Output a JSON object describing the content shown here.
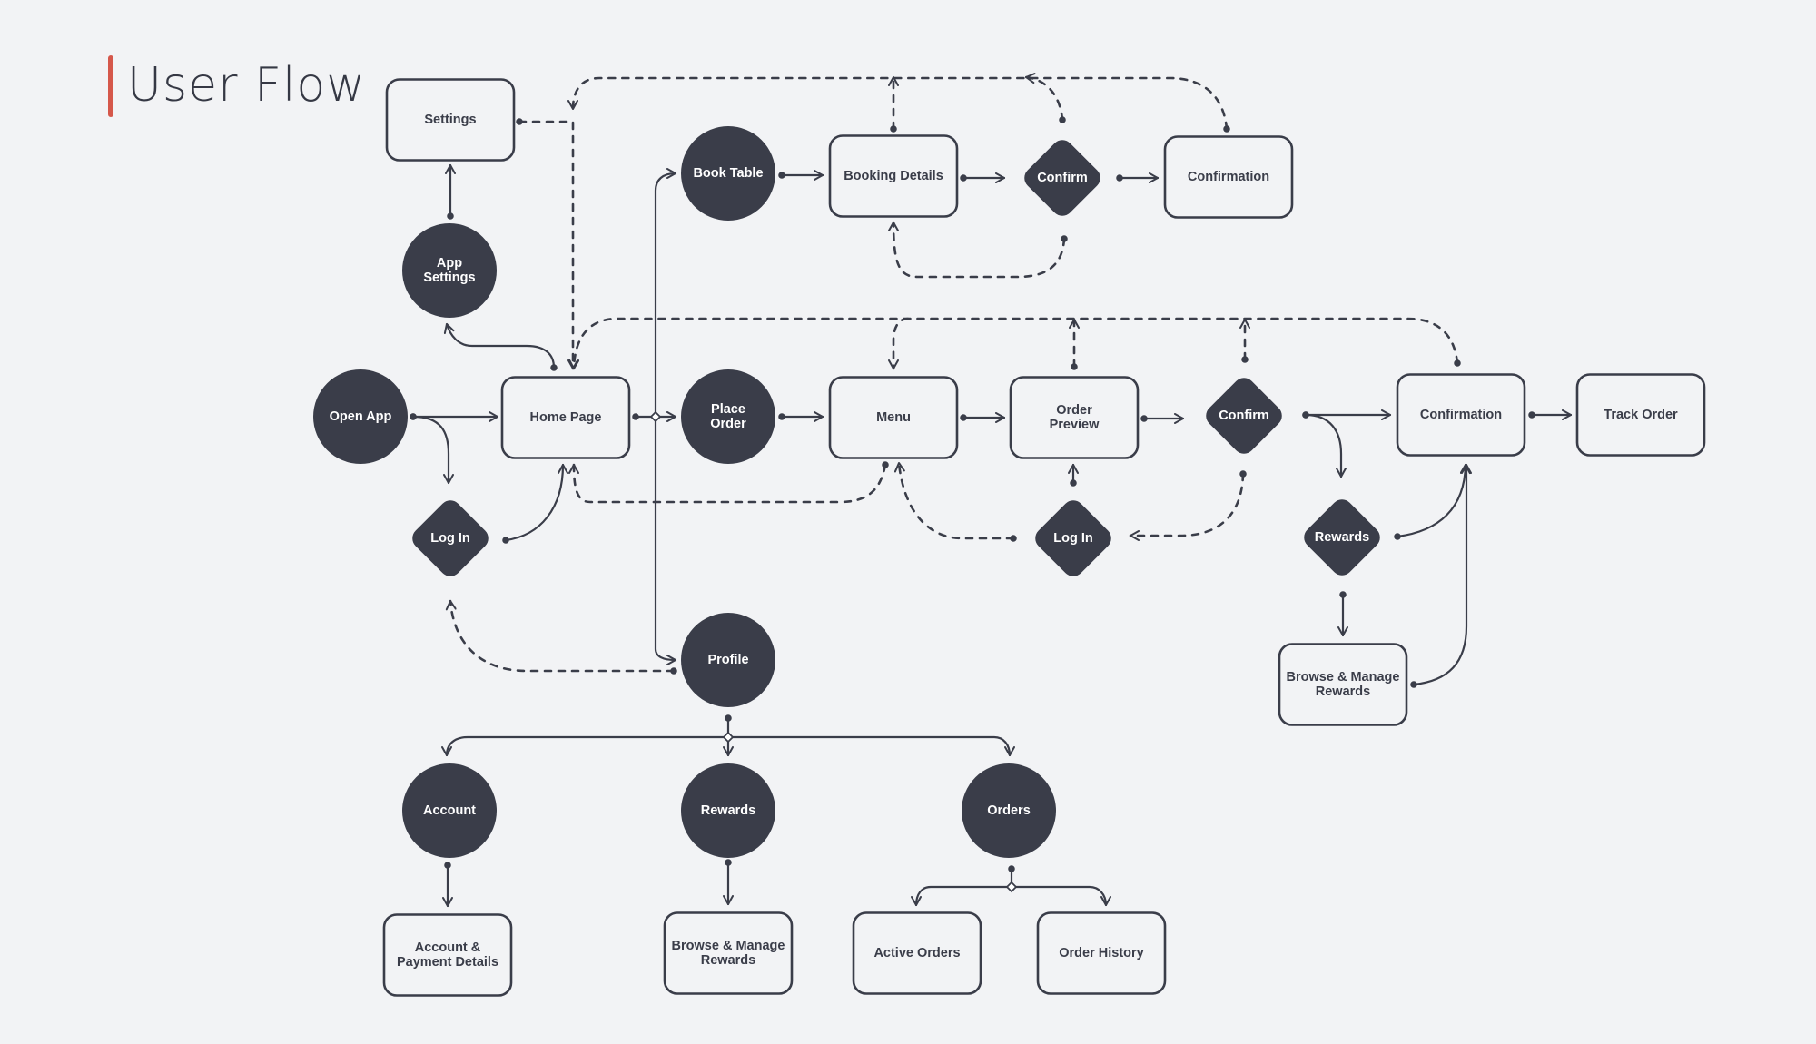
{
  "title": "User Flow",
  "colors": {
    "background": "#f2f3f5",
    "node_dark": "#3a3d49",
    "stroke": "#3a3d49",
    "accent": "#d5574a",
    "box_fill": "#f2f3f5"
  },
  "nodes": [
    {
      "id": "settings",
      "kind": "box",
      "lines": [
        "Settings"
      ]
    },
    {
      "id": "app-settings",
      "kind": "circle",
      "lines": [
        "App",
        "Settings"
      ]
    },
    {
      "id": "open-app",
      "kind": "circle",
      "lines": [
        "Open App"
      ]
    },
    {
      "id": "home-page",
      "kind": "box",
      "lines": [
        "Home Page"
      ]
    },
    {
      "id": "log-in-left",
      "kind": "diamond",
      "lines": [
        "Log In"
      ]
    },
    {
      "id": "book-table",
      "kind": "circle",
      "lines": [
        "Book Table"
      ]
    },
    {
      "id": "booking-details",
      "kind": "box",
      "lines": [
        "Booking Details"
      ]
    },
    {
      "id": "confirm-booking",
      "kind": "diamond",
      "lines": [
        "Confirm"
      ]
    },
    {
      "id": "confirmation-booking",
      "kind": "box",
      "lines": [
        "Confirmation"
      ]
    },
    {
      "id": "place-order",
      "kind": "circle",
      "lines": [
        "Place",
        "Order"
      ]
    },
    {
      "id": "menu",
      "kind": "box",
      "lines": [
        "Menu"
      ]
    },
    {
      "id": "order-preview",
      "kind": "box",
      "lines": [
        "Order",
        "Preview"
      ]
    },
    {
      "id": "confirm-order",
      "kind": "diamond",
      "lines": [
        "Confirm"
      ]
    },
    {
      "id": "confirmation-order",
      "kind": "box",
      "lines": [
        "Confirmation"
      ]
    },
    {
      "id": "track-order",
      "kind": "box",
      "lines": [
        "Track Order"
      ]
    },
    {
      "id": "log-in-order",
      "kind": "diamond",
      "lines": [
        "Log In"
      ]
    },
    {
      "id": "rewards-decision",
      "kind": "diamond",
      "lines": [
        "Rewards"
      ]
    },
    {
      "id": "browse-rewards-order",
      "kind": "box",
      "lines": [
        "Browse & Manage",
        "Rewards"
      ]
    },
    {
      "id": "profile",
      "kind": "circle",
      "lines": [
        "Profile"
      ]
    },
    {
      "id": "account",
      "kind": "circle",
      "lines": [
        "Account"
      ]
    },
    {
      "id": "rewards-profile",
      "kind": "circle",
      "lines": [
        "Rewards"
      ]
    },
    {
      "id": "orders",
      "kind": "circle",
      "lines": [
        "Orders"
      ]
    },
    {
      "id": "account-payment",
      "kind": "box",
      "lines": [
        "Account &",
        "Payment Details"
      ]
    },
    {
      "id": "browse-rewards-profile",
      "kind": "box",
      "lines": [
        "Browse & Manage",
        "Rewards"
      ]
    },
    {
      "id": "active-orders",
      "kind": "box",
      "lines": [
        "Active Orders"
      ]
    },
    {
      "id": "order-history",
      "kind": "box",
      "lines": [
        "Order History"
      ]
    }
  ],
  "edges": [
    {
      "from": "open-app",
      "to": "home-page",
      "style": "solid"
    },
    {
      "from": "open-app",
      "to": "log-in-left",
      "style": "solid"
    },
    {
      "from": "log-in-left",
      "to": "home-page",
      "style": "solid"
    },
    {
      "from": "home-page",
      "to": "app-settings",
      "style": "solid"
    },
    {
      "from": "app-settings",
      "to": "settings",
      "style": "solid"
    },
    {
      "from": "settings",
      "to": "home-page",
      "style": "dashed"
    },
    {
      "from": "home-page",
      "to": "place-order",
      "style": "solid"
    },
    {
      "from": "home-page",
      "to": "book-table",
      "style": "solid"
    },
    {
      "from": "home-page",
      "to": "profile",
      "style": "solid"
    },
    {
      "from": "book-table",
      "to": "booking-details",
      "style": "solid"
    },
    {
      "from": "booking-details",
      "to": "confirm-booking",
      "style": "solid"
    },
    {
      "from": "confirm-booking",
      "to": "confirmation-booking",
      "style": "solid"
    },
    {
      "from": "confirm-booking",
      "to": "booking-details",
      "style": "dashed"
    },
    {
      "from": "booking-details",
      "to": "home-page",
      "style": "dashed"
    },
    {
      "from": "confirm-booking",
      "to": "home-page",
      "style": "dashed"
    },
    {
      "from": "confirmation-booking",
      "to": "home-page",
      "style": "dashed"
    },
    {
      "from": "place-order",
      "to": "menu",
      "style": "solid"
    },
    {
      "from": "menu",
      "to": "order-preview",
      "style": "solid"
    },
    {
      "from": "order-preview",
      "to": "confirm-order",
      "style": "solid"
    },
    {
      "from": "confirm-order",
      "to": "confirmation-order",
      "style": "solid"
    },
    {
      "from": "confirmation-order",
      "to": "track-order",
      "style": "solid"
    },
    {
      "from": "confirm-order",
      "to": "rewards-decision",
      "style": "solid"
    },
    {
      "from": "rewards-decision",
      "to": "confirmation-order",
      "style": "solid"
    },
    {
      "from": "rewards-decision",
      "to": "browse-rewards-order",
      "style": "solid"
    },
    {
      "from": "browse-rewards-order",
      "to": "confirmation-order",
      "style": "solid"
    },
    {
      "from": "confirm-order",
      "to": "log-in-order",
      "style": "dashed"
    },
    {
      "from": "log-in-order",
      "to": "order-preview",
      "style": "solid"
    },
    {
      "from": "log-in-order",
      "to": "menu",
      "style": "dashed"
    },
    {
      "from": "menu",
      "to": "home-page",
      "style": "dashed"
    },
    {
      "from": "order-preview",
      "to": "menu",
      "style": "dashed"
    },
    {
      "from": "confirm-order",
      "to": "menu",
      "style": "dashed"
    },
    {
      "from": "confirmation-order",
      "to": "home-page",
      "style": "dashed"
    },
    {
      "from": "profile",
      "to": "log-in-left",
      "style": "dashed"
    },
    {
      "from": "profile",
      "to": "account",
      "style": "solid"
    },
    {
      "from": "profile",
      "to": "rewards-profile",
      "style": "solid"
    },
    {
      "from": "profile",
      "to": "orders",
      "style": "solid"
    },
    {
      "from": "account",
      "to": "account-payment",
      "style": "solid"
    },
    {
      "from": "rewards-profile",
      "to": "browse-rewards-profile",
      "style": "solid"
    },
    {
      "from": "orders",
      "to": "active-orders",
      "style": "solid"
    },
    {
      "from": "orders",
      "to": "order-history",
      "style": "solid"
    }
  ]
}
